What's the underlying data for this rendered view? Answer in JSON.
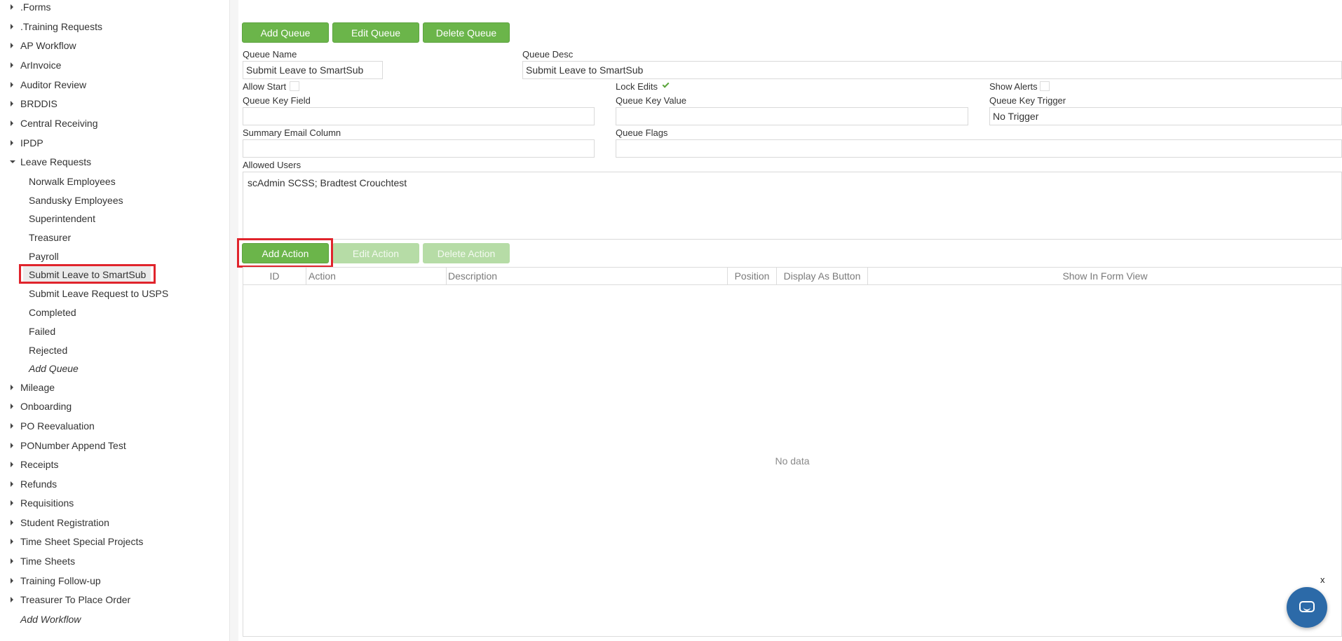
{
  "sidebar": {
    "items": [
      {
        "label": ".Forms"
      },
      {
        "label": ".Training Requests"
      },
      {
        "label": "AP Workflow"
      },
      {
        "label": "ArInvoice"
      },
      {
        "label": "Auditor Review"
      },
      {
        "label": "BRDDIS"
      },
      {
        "label": "Central Receiving"
      },
      {
        "label": "IPDP"
      },
      {
        "label": "Leave Requests"
      },
      {
        "label": "Norwalk Employees"
      },
      {
        "label": "Sandusky Employees"
      },
      {
        "label": "Superintendent"
      },
      {
        "label": "Treasurer"
      },
      {
        "label": "Payroll"
      },
      {
        "label": "Submit Leave to SmartSub"
      },
      {
        "label": "Submit Leave Request to USPS"
      },
      {
        "label": "Completed"
      },
      {
        "label": "Failed"
      },
      {
        "label": "Rejected"
      },
      {
        "label": "Add Queue"
      },
      {
        "label": "Mileage"
      },
      {
        "label": "Onboarding"
      },
      {
        "label": "PO Reevaluation"
      },
      {
        "label": "PONumber Append Test"
      },
      {
        "label": "Receipts"
      },
      {
        "label": "Refunds"
      },
      {
        "label": "Requisitions"
      },
      {
        "label": "Student Registration"
      },
      {
        "label": "Time Sheet Special Projects"
      },
      {
        "label": "Time Sheets"
      },
      {
        "label": "Training Follow-up"
      },
      {
        "label": "Treasurer To Place Order"
      },
      {
        "label": "Add Workflow"
      }
    ]
  },
  "queue_toolbar": {
    "add": "Add Queue",
    "edit": "Edit Queue",
    "delete": "Delete Queue"
  },
  "form": {
    "queue_name_label": "Queue Name",
    "queue_name_value": "Submit Leave to SmartSub",
    "queue_desc_label": "Queue Desc",
    "queue_desc_value": "Submit Leave to SmartSub",
    "allow_start_label": "Allow Start",
    "allow_start_checked": false,
    "lock_edits_label": "Lock Edits",
    "lock_edits_checked": true,
    "show_alerts_label": "Show Alerts",
    "show_alerts_checked": false,
    "queue_key_field_label": "Queue Key Field",
    "queue_key_field_value": "",
    "queue_key_value_label": "Queue Key Value",
    "queue_key_value_value": "",
    "queue_key_trigger_label": "Queue Key Trigger",
    "queue_key_trigger_value": "No Trigger",
    "summary_email_label": "Summary Email Column",
    "summary_email_value": "",
    "queue_flags_label": "Queue Flags",
    "queue_flags_value": "",
    "allowed_users_label": "Allowed Users",
    "allowed_users_value": "scAdmin SCSS; Bradtest Crouchtest"
  },
  "action_toolbar": {
    "add": "Add Action",
    "edit": "Edit Action",
    "delete": "Delete Action"
  },
  "grid": {
    "columns": [
      "ID",
      "Action",
      "Description",
      "Position",
      "Display As Button",
      "Show In Form View"
    ],
    "empty_text": "No data"
  },
  "chat": {
    "close_label": "x"
  },
  "colors": {
    "button_green": "#6bb54a",
    "button_disabled": "#b6dca6",
    "highlight_red": "#e0242c",
    "chat_blue": "#2c6aa8"
  }
}
